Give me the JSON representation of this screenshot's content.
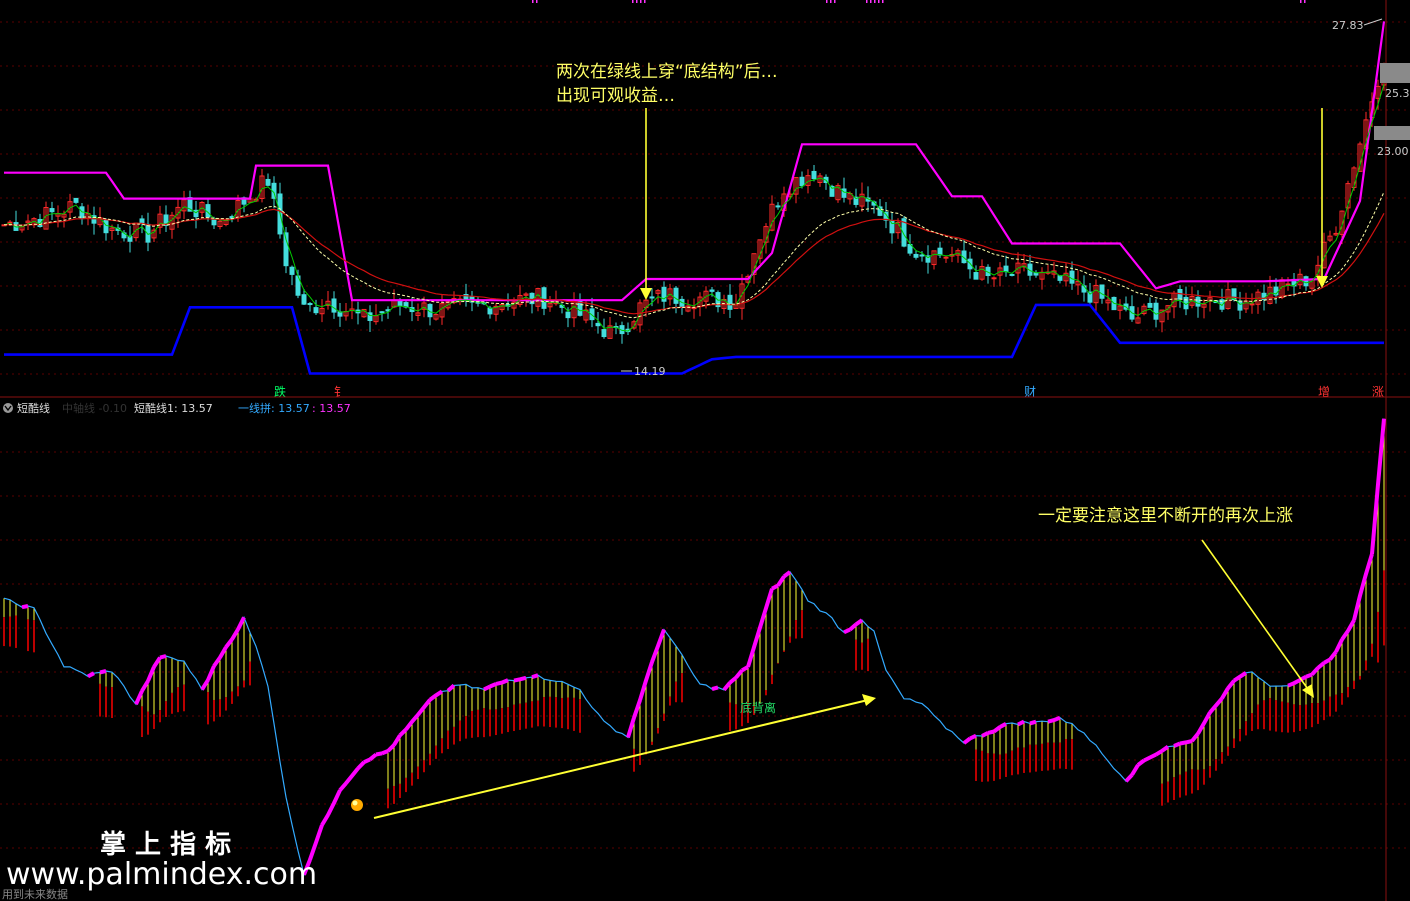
{
  "colors": {
    "background": "#000000",
    "grid": "#5a0000",
    "axis_line": "#8a1010",
    "magenta": "#ff00ff",
    "green": "#00cc00",
    "blue": "#0000ff",
    "red_ma": "#d01010",
    "yellow_dash": "#ffffaa",
    "candle_up": "#ff2a2a",
    "candle_down": "#44dddd",
    "cyan_line": "#33aaff",
    "yellow": "#ffff33",
    "annot_yellow": "#ffff66",
    "label_gray": "#cccccc",
    "dark_red_bar": "#bb0000"
  },
  "top_panel": {
    "price_labels": {
      "high": "27.83",
      "mid": "25.3",
      "low_mid": "23.00",
      "low": "14.19"
    },
    "annotation_line1": "两次在绿线上穿“底结构”后…",
    "annotation_line2": "出现可观收益…",
    "signals": [
      {
        "text": "跌",
        "color": "#00ff66"
      },
      {
        "text": "钅",
        "color": "#ff3333"
      },
      {
        "text": "财",
        "color": "#33aaff"
      },
      {
        "text": "增",
        "color": "#ff3333"
      },
      {
        "text": "涨",
        "color": "#ff3333"
      }
    ]
  },
  "indicator_header": {
    "name": "短酷线",
    "faded_label": "中轴线 -0.10",
    "line1_label": "短酷线1: 13.57",
    "line2_label": "一线拼: 13.57",
    "line2_value": ": 13.57"
  },
  "bottom_panel": {
    "annotation": "一定要注意这里不断开的再次上涨",
    "divergence_label": "底背离"
  },
  "watermark": {
    "title": "掌 上 指 标",
    "url": "www.palmindex.com",
    "footer": "用到未来数据"
  },
  "chart_data": {
    "type": "candlestick",
    "title": "",
    "xlabel": "",
    "ylabel": "",
    "ylim": [
      13.0,
      29.0
    ],
    "x_range": [
      0,
      230
    ],
    "price_extremes": {
      "high": 27.83,
      "low": 14.19
    },
    "close_anchors": [
      [
        0,
        20.0
      ],
      [
        6,
        20.3
      ],
      [
        12,
        20.8
      ],
      [
        18,
        19.8
      ],
      [
        24,
        19.6
      ],
      [
        30,
        20.9
      ],
      [
        36,
        20.1
      ],
      [
        40,
        21.0
      ],
      [
        44,
        21.9
      ],
      [
        47,
        18.5
      ],
      [
        50,
        16.4
      ],
      [
        54,
        16.8
      ],
      [
        60,
        16.0
      ],
      [
        66,
        16.6
      ],
      [
        72,
        16.4
      ],
      [
        78,
        16.5
      ],
      [
        84,
        16.8
      ],
      [
        90,
        16.9
      ],
      [
        96,
        16.2
      ],
      [
        102,
        15.3
      ],
      [
        106,
        16.5
      ],
      [
        110,
        17.0
      ],
      [
        116,
        16.9
      ],
      [
        122,
        16.8
      ],
      [
        126,
        19.6
      ],
      [
        130,
        21.6
      ],
      [
        135,
        22.3
      ],
      [
        140,
        21.2
      ],
      [
        146,
        20.6
      ],
      [
        152,
        18.9
      ],
      [
        158,
        18.7
      ],
      [
        164,
        17.7
      ],
      [
        170,
        18.0
      ],
      [
        176,
        17.6
      ],
      [
        182,
        17.0
      ],
      [
        188,
        16.0
      ],
      [
        194,
        16.6
      ],
      [
        200,
        16.9
      ],
      [
        206,
        16.8
      ],
      [
        212,
        17.2
      ],
      [
        218,
        17.8
      ],
      [
        222,
        20.0
      ],
      [
        226,
        23.5
      ],
      [
        230,
        27.2
      ]
    ],
    "upper_band_anchors": [
      [
        0,
        22.2
      ],
      [
        17,
        22.2
      ],
      [
        20,
        21.1
      ],
      [
        41,
        21.1
      ],
      [
        42,
        22.5
      ],
      [
        54,
        22.5
      ],
      [
        58,
        16.8
      ],
      [
        103,
        16.8
      ],
      [
        107,
        17.7
      ],
      [
        124,
        17.7
      ],
      [
        128,
        18.8
      ],
      [
        133,
        23.4
      ],
      [
        152,
        23.4
      ],
      [
        158,
        21.2
      ],
      [
        163,
        21.2
      ],
      [
        168,
        19.2
      ],
      [
        186,
        19.2
      ],
      [
        192,
        17.3
      ],
      [
        196,
        17.6
      ],
      [
        210,
        17.6
      ],
      [
        220,
        17.7
      ],
      [
        226,
        21.0
      ],
      [
        230,
        28.6
      ]
    ],
    "lower_band_anchors": [
      [
        0,
        14.5
      ],
      [
        28,
        14.5
      ],
      [
        31,
        16.5
      ],
      [
        48,
        16.5
      ],
      [
        51,
        13.7
      ],
      [
        113,
        13.7
      ],
      [
        118,
        14.3
      ],
      [
        122,
        14.4
      ],
      [
        168,
        14.4
      ],
      [
        172,
        16.6
      ],
      [
        181,
        16.6
      ],
      [
        186,
        15.0
      ],
      [
        230,
        15.0
      ]
    ],
    "series": [
      {
        "name": "",
        "role": "upper-band",
        "color": "magenta"
      },
      {
        "name": "",
        "role": "lower-band",
        "color": "blue"
      },
      {
        "name": "",
        "role": "short-ma",
        "color": "green"
      },
      {
        "name": "",
        "role": "long-ma",
        "color": "red"
      },
      {
        "name": "",
        "role": "dashed-ma",
        "color": "yellow"
      }
    ],
    "indicator": {
      "type": "line+histogram",
      "ylim": [
        0,
        100
      ],
      "anchors": [
        [
          0,
          62
        ],
        [
          5,
          60
        ],
        [
          10,
          48
        ],
        [
          14,
          46
        ],
        [
          18,
          47
        ],
        [
          22,
          40
        ],
        [
          26,
          50
        ],
        [
          30,
          49
        ],
        [
          33,
          43
        ],
        [
          36,
          50
        ],
        [
          40,
          58
        ],
        [
          42,
          52
        ],
        [
          44,
          44
        ],
        [
          47,
          20
        ],
        [
          50,
          4
        ],
        [
          53,
          14
        ],
        [
          56,
          22
        ],
        [
          60,
          28
        ],
        [
          64,
          30
        ],
        [
          68,
          36
        ],
        [
          72,
          42
        ],
        [
          76,
          44
        ],
        [
          80,
          43
        ],
        [
          84,
          45
        ],
        [
          88,
          46
        ],
        [
          92,
          45
        ],
        [
          96,
          43
        ],
        [
          100,
          36
        ],
        [
          104,
          33
        ],
        [
          106,
          41
        ],
        [
          110,
          56
        ],
        [
          113,
          50
        ],
        [
          116,
          44
        ],
        [
          120,
          43
        ],
        [
          124,
          48
        ],
        [
          128,
          64
        ],
        [
          131,
          68
        ],
        [
          134,
          62
        ],
        [
          138,
          58
        ],
        [
          140,
          55
        ],
        [
          143,
          58
        ],
        [
          145,
          55
        ],
        [
          147,
          47
        ],
        [
          150,
          41
        ],
        [
          153,
          40
        ],
        [
          156,
          36
        ],
        [
          160,
          32
        ],
        [
          164,
          34
        ],
        [
          168,
          36
        ],
        [
          172,
          36
        ],
        [
          176,
          37
        ],
        [
          180,
          34
        ],
        [
          184,
          28
        ],
        [
          187,
          24
        ],
        [
          190,
          28
        ],
        [
          194,
          31
        ],
        [
          198,
          32
        ],
        [
          202,
          40
        ],
        [
          206,
          46
        ],
        [
          208,
          47
        ],
        [
          211,
          44
        ],
        [
          215,
          44
        ],
        [
          218,
          46
        ],
        [
          222,
          51
        ],
        [
          225,
          58
        ],
        [
          228,
          72
        ],
        [
          230,
          100
        ]
      ]
    }
  }
}
